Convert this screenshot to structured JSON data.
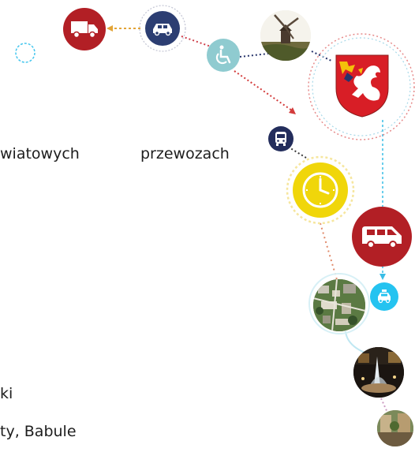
{
  "text": {
    "line1_left": "wiatowych",
    "line1_right": "przewozach",
    "line2": "ki",
    "line3": "ty, Babule"
  },
  "icons": [
    {
      "id": "truck",
      "name": "delivery-truck-icon",
      "color": "#b21f25"
    },
    {
      "id": "car",
      "name": "car-icon",
      "color": "#2c3e72"
    },
    {
      "id": "wheelchair",
      "name": "wheelchair-icon",
      "color": "#8fcbd0"
    },
    {
      "id": "windmill",
      "name": "windmill-photo"
    },
    {
      "id": "crest",
      "name": "coat-of-arms-griffin"
    },
    {
      "id": "bus",
      "name": "bus-icon",
      "color": "#232d5c"
    },
    {
      "id": "clock",
      "name": "clock-icon",
      "color": "#f0d60a"
    },
    {
      "id": "van",
      "name": "van-icon",
      "color": "#b21f25"
    },
    {
      "id": "taxi",
      "name": "taxi-icon",
      "color": "#25c3f0"
    },
    {
      "id": "aerial",
      "name": "aerial-town-photo"
    },
    {
      "id": "fountain",
      "name": "fountain-night-photo"
    },
    {
      "id": "street",
      "name": "street-photo"
    }
  ]
}
